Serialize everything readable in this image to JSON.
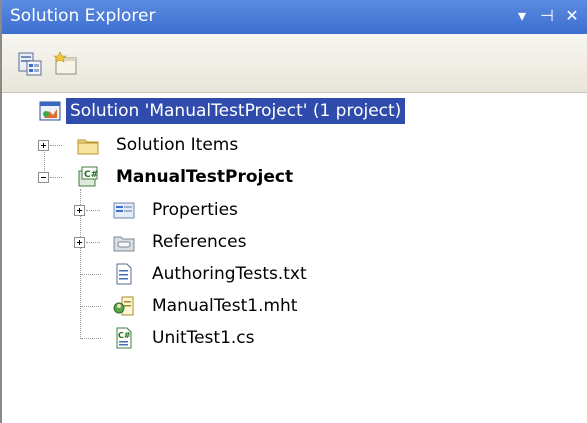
{
  "window": {
    "title": "Solution Explorer",
    "buttons": {
      "dropdown": "▾",
      "pin": "⊣",
      "close": "✕"
    }
  },
  "toolbar": {
    "items": [
      {
        "name": "properties-icon"
      },
      {
        "name": "show-all-files-icon"
      }
    ]
  },
  "tree": {
    "solution": "Solution 'ManualTestProject' (1 project)",
    "solution_items": "Solution Items",
    "project": "ManualTestProject",
    "properties": "Properties",
    "references": "References",
    "authoring_tests": "AuthoringTests.txt",
    "manual_test": "ManualTest1.mht",
    "unit_test": "UnitTest1.cs"
  },
  "colors": {
    "titlebar": "#3d6fd0",
    "selection": "#2f4bab",
    "toolbar": "#ece9d8"
  }
}
